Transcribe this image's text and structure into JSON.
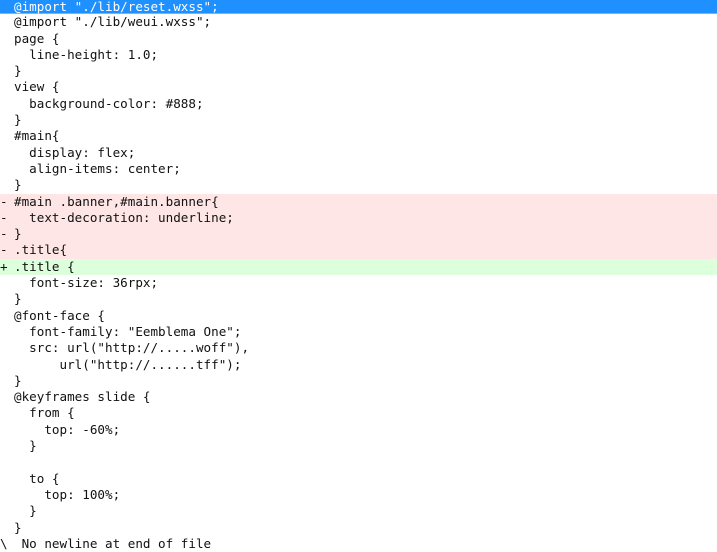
{
  "diff": {
    "lines": [
      {
        "type": "sel",
        "mark": "",
        "text": "@import \"./lib/reset.wxss\";"
      },
      {
        "type": "ctx",
        "mark": "",
        "text": "@import \"./lib/weui.wxss\";"
      },
      {
        "type": "ctx",
        "mark": "",
        "text": "page {"
      },
      {
        "type": "ctx",
        "mark": "",
        "text": "  line-height: 1.0;"
      },
      {
        "type": "ctx",
        "mark": "",
        "text": "}"
      },
      {
        "type": "ctx",
        "mark": "",
        "text": "view {"
      },
      {
        "type": "ctx",
        "mark": "",
        "text": "  background-color: #888;"
      },
      {
        "type": "ctx",
        "mark": "",
        "text": "}"
      },
      {
        "type": "ctx",
        "mark": "",
        "text": "#main{"
      },
      {
        "type": "ctx",
        "mark": "",
        "text": "  display: flex;"
      },
      {
        "type": "ctx",
        "mark": "",
        "text": "  align-items: center;"
      },
      {
        "type": "ctx",
        "mark": "",
        "text": "}"
      },
      {
        "type": "del",
        "mark": "-",
        "text": "#main .banner,#main.banner{"
      },
      {
        "type": "del",
        "mark": "-",
        "text": "  text-decoration: underline;"
      },
      {
        "type": "del",
        "mark": "-",
        "text": "}"
      },
      {
        "type": "del",
        "mark": "-",
        "text": ".title{"
      },
      {
        "type": "add",
        "mark": "+",
        "text": ".title {"
      },
      {
        "type": "ctx",
        "mark": "",
        "text": "  font-size: 36rpx;"
      },
      {
        "type": "ctx",
        "mark": "",
        "text": "}"
      },
      {
        "type": "ctx",
        "mark": "",
        "text": "@font-face {"
      },
      {
        "type": "ctx",
        "mark": "",
        "text": "  font-family: \"Eemblema One\";"
      },
      {
        "type": "ctx",
        "mark": "",
        "text": "  src: url(\"http://.....woff\"),"
      },
      {
        "type": "ctx",
        "mark": "",
        "text": "      url(\"http://......tff\");"
      },
      {
        "type": "ctx",
        "mark": "",
        "text": "}"
      },
      {
        "type": "ctx",
        "mark": "",
        "text": "@keyframes slide {"
      },
      {
        "type": "ctx",
        "mark": "",
        "text": "  from {"
      },
      {
        "type": "ctx",
        "mark": "",
        "text": "    top: -60%;"
      },
      {
        "type": "ctx",
        "mark": "",
        "text": "  }"
      },
      {
        "type": "ctx",
        "mark": "",
        "text": ""
      },
      {
        "type": "ctx",
        "mark": "",
        "text": "  to {"
      },
      {
        "type": "ctx",
        "mark": "",
        "text": "    top: 100%;"
      },
      {
        "type": "ctx",
        "mark": "",
        "text": "  }"
      },
      {
        "type": "ctx",
        "mark": "",
        "text": "}"
      },
      {
        "type": "ctx",
        "mark": "\\",
        "text": " No newline at end of file"
      }
    ]
  }
}
